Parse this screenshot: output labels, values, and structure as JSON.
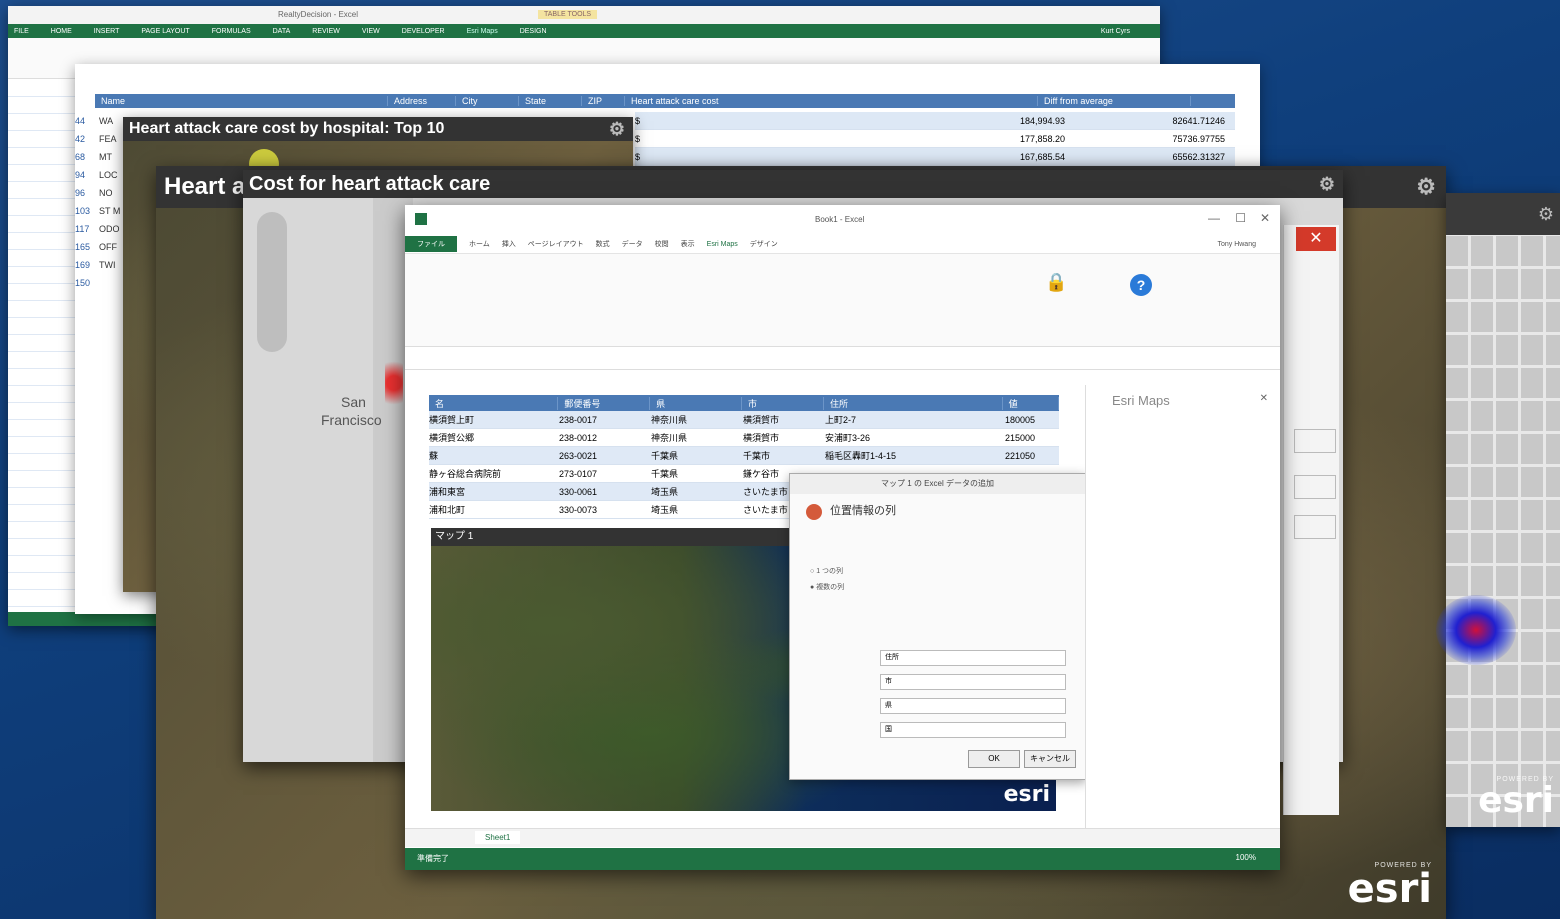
{
  "back_excel": {
    "title": "RealtyDecision - Excel",
    "tabs": [
      "FILE",
      "HOME",
      "INSERT",
      "PAGE LAYOUT",
      "FORMULAS",
      "DATA",
      "REVIEW",
      "VIEW",
      "DEVELOPER",
      "Esri Maps",
      "DESIGN"
    ],
    "context_tab": "TABLE TOOLS",
    "user": "Kurt Cyrs",
    "col_headers": [
      "Name",
      "Address",
      "City",
      "State",
      "ZIP",
      "Heart attack care cost",
      "Diff from average"
    ],
    "rows": [
      {
        "cost": "184,994.93",
        "diff": "82641.71246"
      },
      {
        "cost": "177,858.20",
        "diff": "75736.97755"
      },
      {
        "cost": "167,685.54",
        "diff": "65562.31327"
      }
    ],
    "row_nums": [
      "44",
      "42",
      "68",
      "94",
      "96",
      "103",
      "117",
      "165",
      "169",
      "150"
    ],
    "row_prefix": [
      "WA",
      "FEA",
      "MT",
      "LOC",
      "NO",
      "ST M",
      "ODO",
      "OFF",
      "TWI"
    ]
  },
  "map_panel_1": {
    "title": "Heart attack care cost by hospital: Top 10"
  },
  "map_panel_2": {
    "title_partial": "Heart a"
  },
  "map_panel_3": {
    "title": "Cost for heart attack care",
    "city_label_1": "San",
    "city_label_2": "Francisco"
  },
  "front_excel": {
    "title": "Book1 - Excel",
    "user": "Tony Hwang",
    "tabs": [
      "ファイル",
      "ホーム",
      "挿入",
      "ページレイアウト",
      "数式",
      "データ",
      "校閲",
      "表示",
      "Esri Maps",
      "デザイン"
    ],
    "columns": [
      "名",
      "郵便番号",
      "県",
      "市",
      "住所",
      "値"
    ],
    "rows": [
      [
        "横須賀上町",
        "238-0017",
        "神奈川県",
        "横須賀市",
        "上町2-7",
        "180005"
      ],
      [
        "横須賀公郷",
        "238-0012",
        "神奈川県",
        "横須賀市",
        "安浦町3-26",
        "215000"
      ],
      [
        "蘇",
        "263-0021",
        "千葉県",
        "千葉市",
        "稲毛区轟町1-4-15",
        "221050"
      ],
      [
        "静ヶ谷総合病院前",
        "273-0107",
        "千葉県",
        "鎌ケ谷市",
        "",
        ""
      ],
      [
        "浦和東宮",
        "330-0061",
        "埼玉県",
        "さいたま市",
        "",
        ""
      ],
      [
        "浦和北町",
        "330-0073",
        "埼玉県",
        "さいたま市",
        "",
        ""
      ]
    ],
    "map_title": "マップ 1",
    "side_panel_title": "Esri Maps",
    "sheet_tab": "Sheet1",
    "status": "準備完了",
    "zoom": "100%"
  },
  "dialog": {
    "title": "マップ 1 の Excel データの追加",
    "heading": "位置情報の列",
    "options": [
      "1 つの列",
      "複数の列"
    ],
    "fields": [
      "住所",
      "市",
      "県",
      "国"
    ],
    "ok": "OK",
    "cancel": "キャンセル"
  },
  "branding": {
    "powered_by": "POWERED BY",
    "logo": "esri"
  }
}
